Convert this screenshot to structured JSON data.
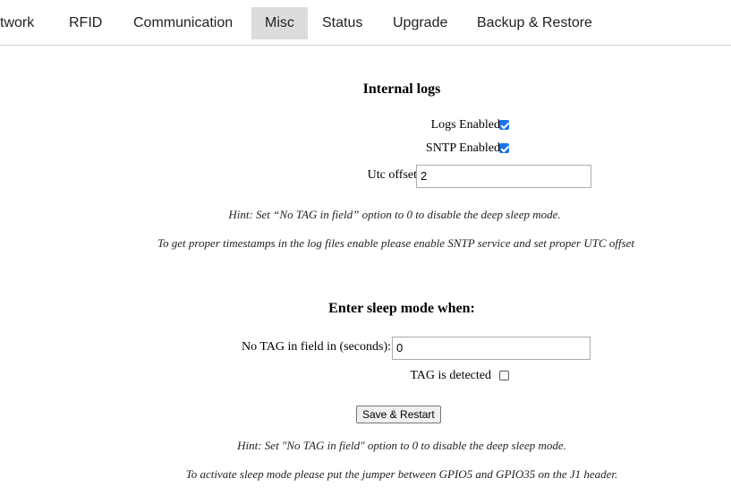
{
  "tabs": [
    {
      "label": "twork",
      "active": false
    },
    {
      "label": "RFID",
      "active": false
    },
    {
      "label": "Communication",
      "active": false
    },
    {
      "label": "Misc",
      "active": true
    },
    {
      "label": "Status",
      "active": false
    },
    {
      "label": "Upgrade",
      "active": false
    },
    {
      "label": "Backup & Restore",
      "active": false
    }
  ],
  "internal_logs": {
    "heading": "Internal logs",
    "logs_enabled": {
      "label": "Logs Enabled",
      "checked": true
    },
    "sntp_enabled": {
      "label": "SNTP Enabled",
      "checked": true
    },
    "utc_offset": {
      "label": "Utc offset",
      "value": "2"
    },
    "hint_1": "Hint: Set “No TAG in field” option to 0 to disable the deep sleep mode.",
    "hint_2": "To get proper timestamps in the log files enable please enable SNTP service and set proper UTC offset"
  },
  "sleep_mode": {
    "heading": "Enter sleep mode when:",
    "no_tag": {
      "label": "No TAG in field in (seconds):",
      "value": "0"
    },
    "tag_detected": {
      "label": "TAG is detected",
      "checked": false
    },
    "save_button": "Save & Restart",
    "hint_1": "Hint: Set \"No TAG in field\" option to 0 to disable the deep sleep mode.",
    "hint_2": "To activate sleep mode please put the jumper between GPIO5 and GPIO35 on the J1 header."
  },
  "colors": {
    "checkbox_accent": "#1a73e8",
    "active_tab": "#dcdcdc"
  }
}
